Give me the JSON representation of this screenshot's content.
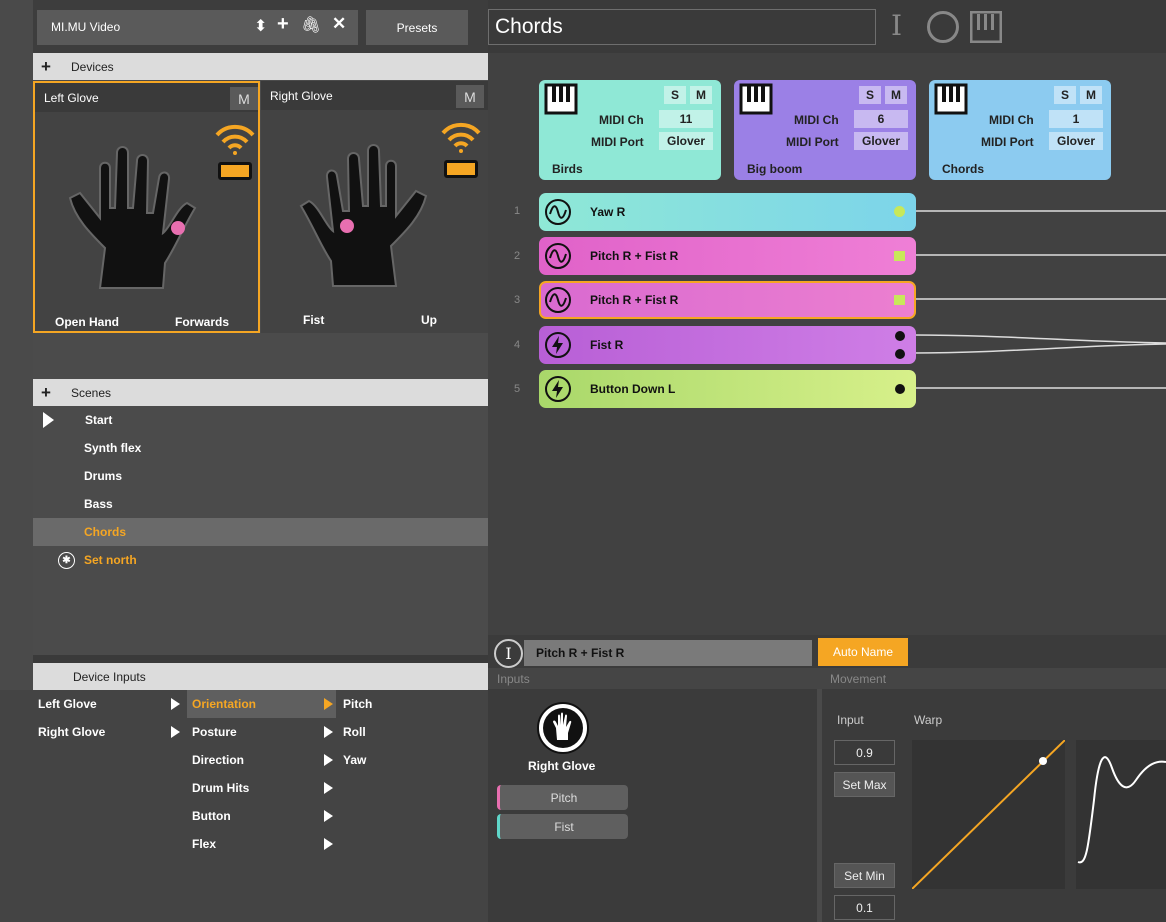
{
  "project": {
    "name": "MI.MU Video",
    "presets_label": "Presets"
  },
  "devices": {
    "header": "Devices",
    "gloves": [
      {
        "name": "Left Glove",
        "m_label": "M",
        "posture": "Open Hand",
        "direction": "Forwards"
      },
      {
        "name": "Right Glove",
        "m_label": "M",
        "posture": "Fist",
        "direction": "Up"
      }
    ]
  },
  "scenes": {
    "header": "Scenes",
    "items": [
      "Start",
      "Synth flex",
      "Drums",
      "Bass",
      "Chords"
    ],
    "set_north": "Set north"
  },
  "device_inputs": {
    "header": "Device Inputs",
    "devices": [
      "Left Glove",
      "Right Glove"
    ],
    "categories": [
      "Orientation",
      "Posture",
      "Direction",
      "Drum Hits",
      "Button",
      "Flex"
    ],
    "orientation_axes": [
      "Pitch",
      "Roll",
      "Yaw"
    ]
  },
  "scene_title": "Chords",
  "instruments": [
    {
      "name": "Birds",
      "midi_ch_label": "MIDI Ch",
      "midi_ch": "11",
      "midi_port_label": "MIDI Port",
      "midi_port": "Glover",
      "s": "S",
      "m": "M",
      "color": "#8fe8d6"
    },
    {
      "name": "Big boom",
      "midi_ch_label": "MIDI Ch",
      "midi_ch": "6",
      "midi_port_label": "MIDI Port",
      "midi_port": "Glover",
      "s": "S",
      "m": "M",
      "color": "#9b80e6"
    },
    {
      "name": "Chords",
      "midi_ch_label": "MIDI Ch",
      "midi_ch": "1",
      "midi_port_label": "MIDI Port",
      "midi_port": "Glover",
      "s": "S",
      "m": "M",
      "color": "#8ccbf0"
    }
  ],
  "tracks": [
    {
      "num": "1",
      "label": "Yaw R",
      "icon": "wave-icon"
    },
    {
      "num": "2",
      "label": "Pitch R + Fist R",
      "icon": "wave-icon"
    },
    {
      "num": "3",
      "label": "Pitch R + Fist R",
      "icon": "wave-icon"
    },
    {
      "num": "4",
      "label": "Fist R",
      "icon": "bolt-icon"
    },
    {
      "num": "5",
      "label": "Button Down L",
      "icon": "bolt-icon"
    }
  ],
  "editor": {
    "name": "Pitch R + Fist R",
    "auto_name": "Auto Name",
    "inputs_header": "Inputs",
    "movement_header": "Movement",
    "device": "Right Glove",
    "input_pills": [
      "Pitch",
      "Fist"
    ],
    "input_label": "Input",
    "warp_label": "Warp",
    "max_value": "0.9",
    "set_max": "Set Max",
    "set_min": "Set Min",
    "min_value": "0.1"
  },
  "colors": {
    "accent": "#f5a623",
    "pink": "#e86fb0"
  }
}
